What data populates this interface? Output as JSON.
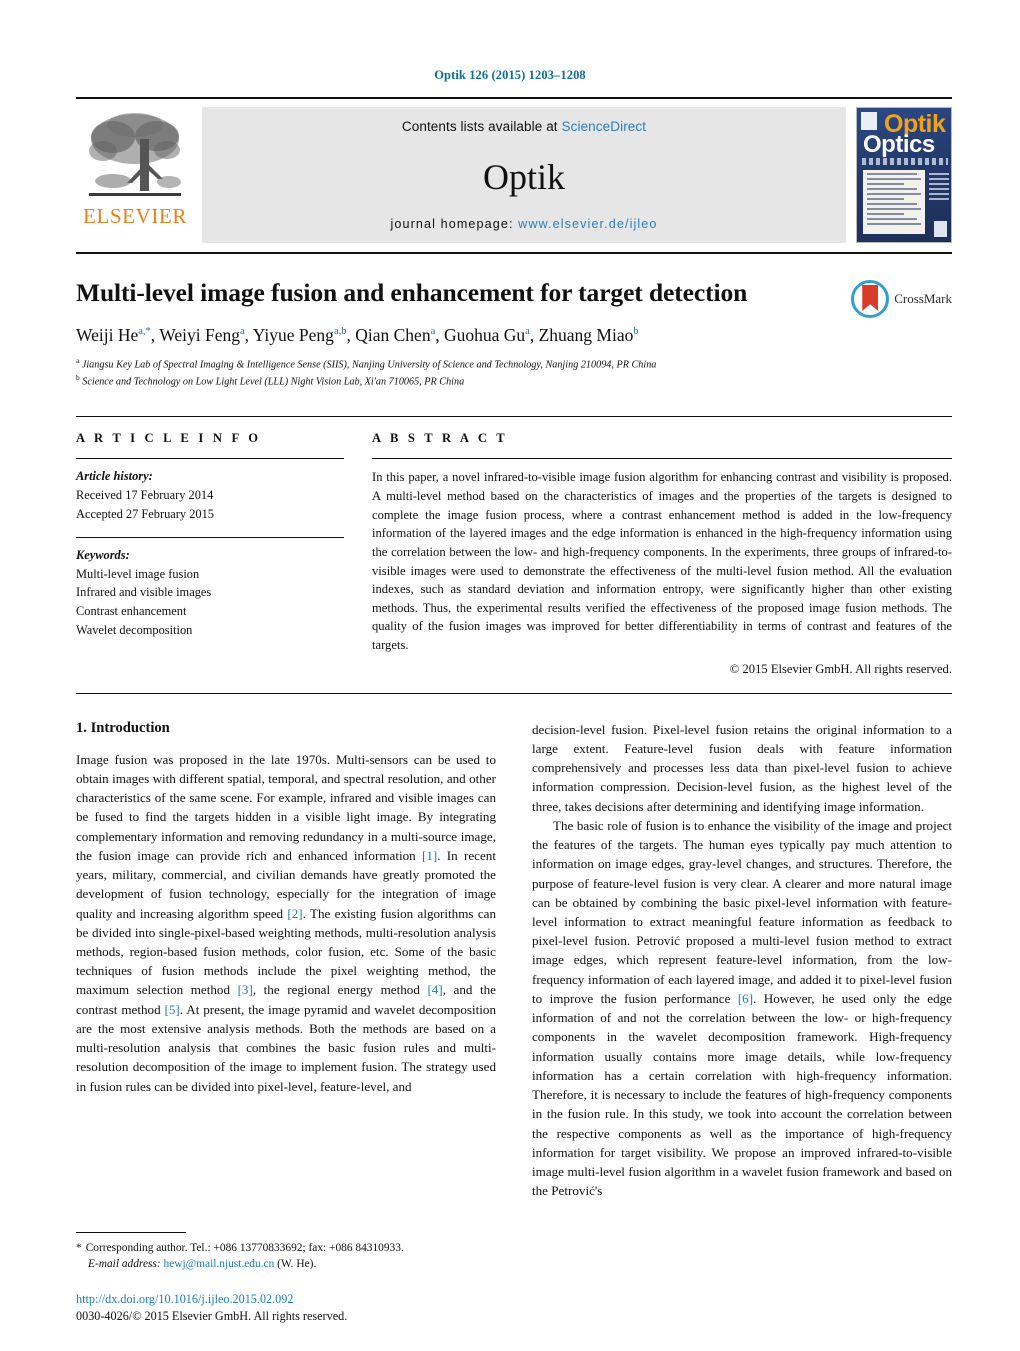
{
  "running_head": "Optik 126 (2015) 1203–1208",
  "masthead": {
    "publisher_wordmark": "ELSEVIER",
    "contents_prefix": "Contents lists available at",
    "contents_link": "ScienceDirect",
    "journal_title": "Optik",
    "homepage_label": "journal homepage:",
    "homepage_url": "www.elsevier.de/ijleo",
    "cover": {
      "title_top": "Optik",
      "title_bottom": "Optics"
    }
  },
  "article": {
    "title": "Multi-level image fusion and enhancement for target detection",
    "authors": [
      {
        "name": "Weiji He",
        "sup": "a,*"
      },
      {
        "name": "Weiyi Feng",
        "sup": "a"
      },
      {
        "name": "Yiyue Peng",
        "sup": "a,b"
      },
      {
        "name": "Qian Chen",
        "sup": "a"
      },
      {
        "name": "Guohua Gu",
        "sup": "a"
      },
      {
        "name": "Zhuang Miao",
        "sup": "b"
      }
    ],
    "affiliations": [
      {
        "marker": "a",
        "text": "Jiangsu Key Lab of Spectral Imaging & Intelligence Sense (SIIS), Nanjing University of Science and Technology, Nanjing 210094, PR China"
      },
      {
        "marker": "b",
        "text": "Science and Technology on Low Light Level (LLL) Night Vision Lab, Xi'an 710065, PR China"
      }
    ],
    "crossmark_label": "CrossMark"
  },
  "article_info": {
    "heading": "A R T I C L E   I N F O",
    "history_label": "Article history:",
    "received": "Received 17 February 2014",
    "accepted": "Accepted 27 February 2015",
    "keywords_label": "Keywords:",
    "keywords": [
      "Multi-level image fusion",
      "Infrared and visible images",
      "Contrast enhancement",
      "Wavelet decomposition"
    ]
  },
  "abstract": {
    "heading": "A B S T R A C T",
    "text": "In this paper, a novel infrared-to-visible image fusion algorithm for enhancing contrast and visibility is proposed. A multi-level method based on the characteristics of images and the properties of the targets is designed to complete the image fusion process, where a contrast enhancement method is added in the low-frequency information of the layered images and the edge information is enhanced in the high-frequency information using the correlation between the low- and high-frequency components. In the experiments, three groups of infrared-to-visible images were used to demonstrate the effectiveness of the multi-level fusion method. All the evaluation indexes, such as standard deviation and information entropy, were significantly higher than other existing methods. Thus, the experimental results verified the effectiveness of the proposed image fusion methods. The quality of the fusion images was improved for better differentiability in terms of contrast and features of the targets.",
    "copyright": "© 2015 Elsevier GmbH. All rights reserved."
  },
  "introduction": {
    "heading": "1.  Introduction",
    "left_paragraphs": [
      "Image fusion was proposed in the late 1970s. Multi-sensors can be used to obtain images with different spatial, temporal, and spectral resolution, and other characteristics of the same scene. For example, infrared and visible images can be fused to find the targets hidden in a visible light image. By integrating complementary information and removing redundancy in a multi-source image, the fusion image can provide rich and enhanced information [1]. In recent years, military, commercial, and civilian demands have greatly promoted the development of fusion technology, especially for the integration of image quality and increasing algorithm speed [2]. The existing fusion algorithms can be divided into single-pixel-based weighting methods, multi-resolution analysis methods, region-based fusion methods, color fusion, etc. Some of the basic techniques of fusion methods include the pixel weighting method, the maximum selection method [3], the regional energy method [4], and the contrast method [5]. At present, the image pyramid and wavelet decomposition are the most extensive analysis methods. Both the methods are based on a multi-resolution analysis that combines the basic fusion rules and multi-resolution decomposition of the image to implement fusion. The strategy used in fusion rules can be divided into pixel-level, feature-level, and"
    ],
    "right_paragraphs": [
      "decision-level fusion. Pixel-level fusion retains the original information to a large extent. Feature-level fusion deals with feature information comprehensively and processes less data than pixel-level fusion to achieve information compression. Decision-level fusion, as the highest level of the three, takes decisions after determining and identifying image information.",
      "The basic role of fusion is to enhance the visibility of the image and project the features of the targets. The human eyes typically pay much attention to information on image edges, gray-level changes, and structures. Therefore, the purpose of feature-level fusion is very clear. A clearer and more natural image can be obtained by combining the basic pixel-level information with feature-level information to extract meaningful feature information as feedback to pixel-level fusion. Petrović proposed a multi-level fusion method to extract image edges, which represent feature-level information, from the low-frequency information of each layered image, and added it to pixel-level fusion to improve the fusion performance [6]. However, he used only the edge information of and not the correlation between the low- or high-frequency components in the wavelet decomposition framework. High-frequency information usually contains more image details, while low-frequency information has a certain correlation with high-frequency information. Therefore, it is necessary to include the features of high-frequency components in the fusion rule. In this study, we took into account the correlation between the respective components as well as the importance of high-frequency information for target visibility. We propose an improved infrared-to-visible image multi-level fusion algorithm in a wavelet fusion framework and based on the Petrović's"
    ]
  },
  "footnotes": {
    "corresponding": "Corresponding author. Tel.: +086 13770833692; fax: +086 84310933.",
    "email_label": "E-mail address:",
    "email": "hewj@mail.njust.edu.cn",
    "email_suffix": "(W. He)."
  },
  "footer": {
    "doi": "http://dx.doi.org/10.1016/j.ijleo.2015.02.092",
    "issn_line": "0030-4026/© 2015 Elsevier GmbH. All rights reserved."
  },
  "colors": {
    "link": "#1b7fb5",
    "elsevier_orange": "#ef7d1a",
    "crossmark_blue": "#2f9fd0",
    "crossmark_red": "#d73b2a"
  }
}
